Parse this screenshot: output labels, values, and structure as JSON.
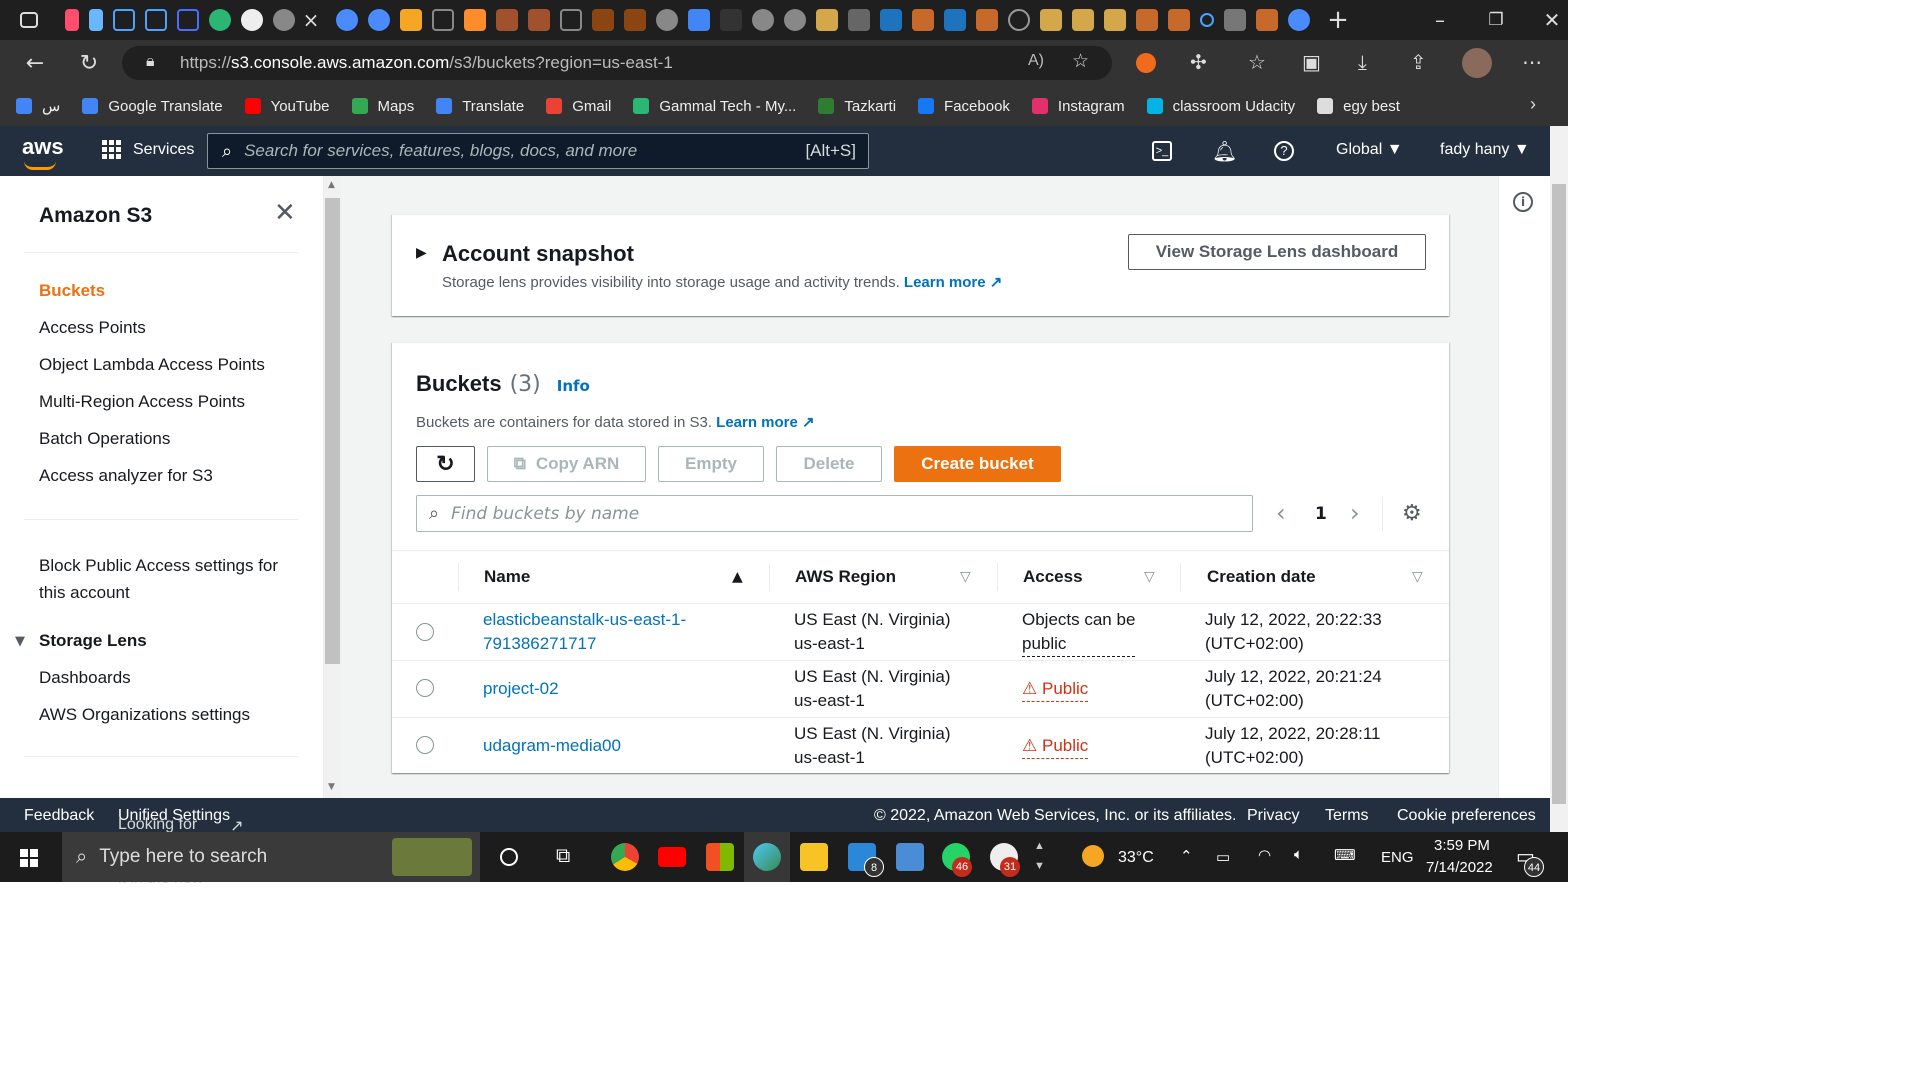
{
  "browser": {
    "url_prefix": "https://",
    "url_host": "s3.console.aws.amazon.com",
    "url_path": "/s3/buckets?region=us-east-1",
    "bookmarks": [
      {
        "label": "س",
        "color": "#4285f4"
      },
      {
        "label": "Google Translate",
        "color": "#4285f4"
      },
      {
        "label": "YouTube",
        "color": "#ff0000"
      },
      {
        "label": "Maps",
        "color": "#34a853"
      },
      {
        "label": "Translate",
        "color": "#4285f4"
      },
      {
        "label": "Gmail",
        "color": "#ea4335"
      },
      {
        "label": "Gammal Tech - My...",
        "color": "#2bb673"
      },
      {
        "label": "Tazkarti",
        "color": "#2e7d32"
      },
      {
        "label": "Facebook",
        "color": "#1877f2"
      },
      {
        "label": "Instagram",
        "color": "#e1306c"
      },
      {
        "label": "classroom Udacity",
        "color": "#02b3e4"
      },
      {
        "label": "egy best",
        "color": "#dddddd"
      }
    ]
  },
  "aws_nav": {
    "logo": "aws",
    "services": "Services",
    "search_placeholder": "Search for services, features, blogs, docs, and more",
    "search_shortcut": "[Alt+S]",
    "region": "Global ▼",
    "user": "fady hany ▼"
  },
  "sidebar": {
    "title": "Amazon S3",
    "items": [
      {
        "label": "Buckets",
        "active": true
      },
      {
        "label": "Access Points"
      },
      {
        "label": "Object Lambda Access Points"
      },
      {
        "label": "Multi-Region Access Points"
      },
      {
        "label": "Batch Operations"
      },
      {
        "label": "Access analyzer for S3"
      }
    ],
    "block_public_line1": "Block Public Access settings for",
    "block_public_line2": "this account",
    "storage_lens": "Storage Lens",
    "storage_lens_items": [
      "Dashboards",
      "AWS Organizations settings"
    ]
  },
  "snapshot": {
    "title": "Account snapshot",
    "desc": "Storage lens provides visibility into storage usage and activity trends.",
    "learn_more": "Learn more",
    "button": "View Storage Lens dashboard"
  },
  "buckets": {
    "title": "Buckets",
    "count": "(3)",
    "info": "Info",
    "desc": "Buckets are containers for data stored in S3.",
    "learn_more": "Learn more",
    "actions": {
      "copy_arn": "Copy ARN",
      "empty": "Empty",
      "delete": "Delete",
      "create": "Create bucket"
    },
    "search_placeholder": "Find buckets by name",
    "page": "1",
    "columns": [
      "Name",
      "AWS Region",
      "Access",
      "Creation date"
    ],
    "rows": [
      {
        "name1": "elasticbeanstalk-us-east-1-",
        "name2": "791386271717",
        "region1": "US East (N. Virginia)",
        "region2": "us-east-1",
        "access1": "Objects can be",
        "access2": "public",
        "date1": "July 12, 2022, 20:22:33",
        "date2": "(UTC+02:00)"
      },
      {
        "name1": "project-02",
        "region1": "US East (N. Virginia)",
        "region2": "us-east-1",
        "access1": "Public",
        "date1": "July 12, 2022, 20:21:24",
        "date2": "(UTC+02:00)"
      },
      {
        "name1": "udagram-media00",
        "region1": "US East (N. Virginia)",
        "region2": "us-east-1",
        "access1": "Public",
        "date1": "July 12, 2022, 20:28:11",
        "date2": "(UTC+02:00)"
      }
    ]
  },
  "footer": {
    "feedback": "Feedback",
    "language_msg": "Looking for language selection? Find it in the new",
    "unified_settings": "Unified Settings",
    "copyright": "© 2022, Amazon Web Services, Inc. or its affiliates.",
    "privacy": "Privacy",
    "terms": "Terms",
    "cookies": "Cookie preferences"
  },
  "taskbar": {
    "search_placeholder": "Type here to search",
    "weather": "33°C",
    "lang": "ENG",
    "time": "3:59 PM",
    "date": "7/14/2022",
    "mail_badge": "8",
    "whatsapp_badge": "46",
    "slack_badge": "31",
    "notif_badge": "44"
  },
  "colors": {
    "aws_orange": "#ec7211",
    "aws_nav": "#232f3e",
    "link": "#0073bb",
    "public_red": "#d13212"
  }
}
